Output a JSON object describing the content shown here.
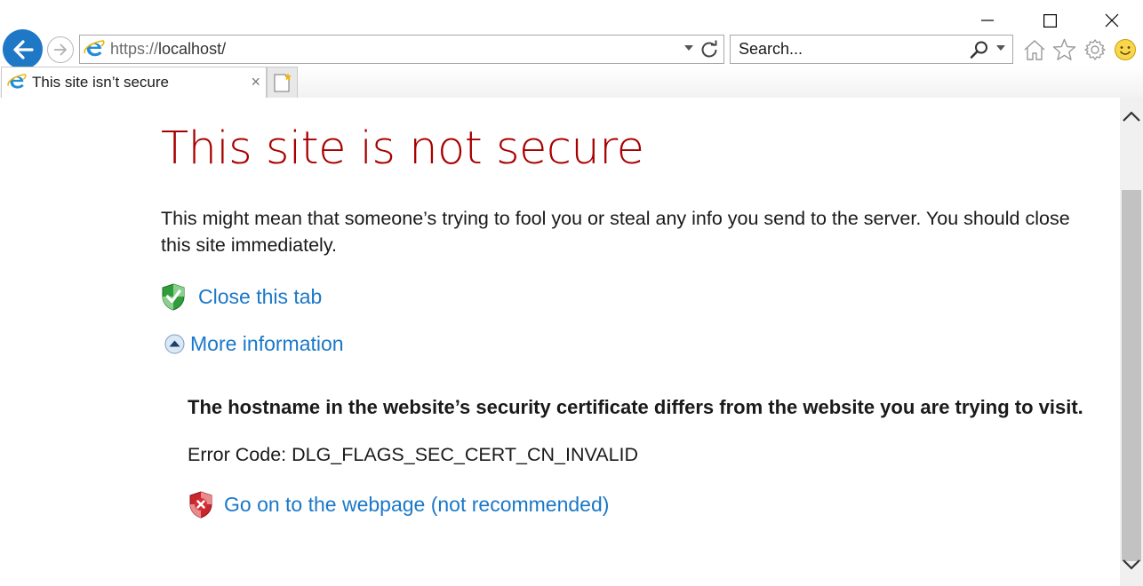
{
  "browser": {
    "url_protocol": "https://",
    "url_host": "localhost/",
    "search_placeholder": "Search...",
    "tab_title": "This site isn’t secure"
  },
  "page": {
    "heading": "This site is not secure",
    "description": "This might mean that someone’s trying to fool you or steal any info you send to the server. You should close this site immediately.",
    "close_tab_label": "Close this tab",
    "more_info_label": "More information",
    "hostname_message": "The hostname in the website’s security certificate differs from the website you are trying to visit.",
    "error_code": "Error Code: DLG_FLAGS_SEC_CERT_CN_INVALID",
    "go_on_label": "Go on to the webpage (not recommended)"
  },
  "colors": {
    "heading": "#a80000",
    "link": "#1a78c8",
    "back_button": "#1f78c6"
  },
  "icons": [
    "minimize-icon",
    "maximize-icon",
    "close-window-icon",
    "back-arrow-icon",
    "forward-arrow-icon",
    "ie-logo-icon",
    "dropdown-arrow-icon",
    "refresh-icon",
    "search-icon",
    "home-icon",
    "favorites-star-icon",
    "settings-gear-icon",
    "feedback-smiley-icon",
    "tab-close-icon",
    "new-tab-icon",
    "shield-check-icon",
    "expand-up-icon",
    "shield-error-icon",
    "scroll-up-icon",
    "scroll-down-icon"
  ]
}
